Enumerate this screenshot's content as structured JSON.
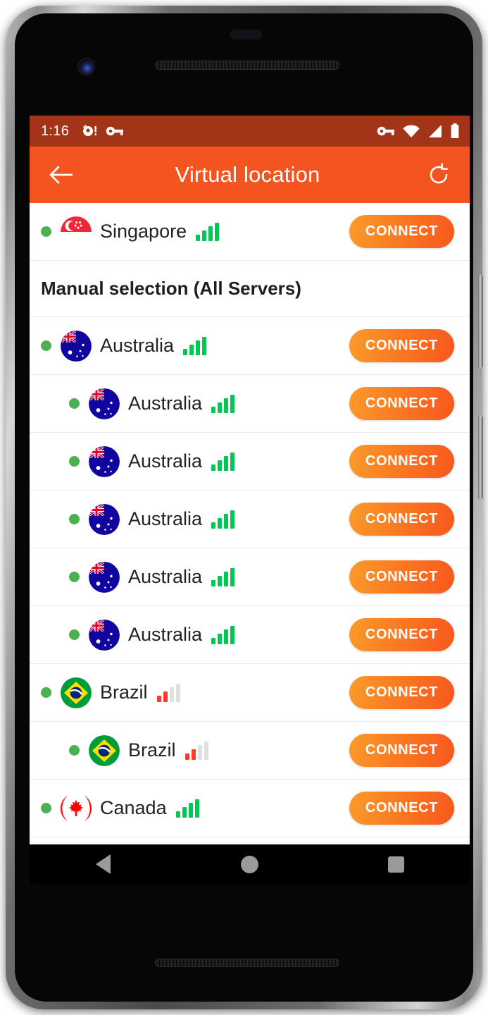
{
  "status_bar": {
    "clock": "1:16",
    "left_icons": [
      "alarm-notification-icon",
      "vpn-key-icon"
    ],
    "right_icons": [
      "vpn-key-icon",
      "wifi-icon",
      "cellular-signal-icon",
      "battery-icon"
    ],
    "background_color": "#A33418",
    "foreground_color": "#FFFFFF"
  },
  "app_bar": {
    "title": "Virtual location",
    "back_icon": "arrow-left-icon",
    "refresh_icon": "refresh-icon",
    "background_color": "#F4541F",
    "text_color": "#FFFFFF"
  },
  "list": {
    "section_header": "Manual selection (All Servers)",
    "connect_label": "CONNECT",
    "status_dot_color": "#4CAF50",
    "signal_good_color": "#00C853",
    "signal_weak_color": "#FF3B30",
    "signal_empty_color": "#E0E0E0",
    "connect_gradient_from": "#FB9B2B",
    "connect_gradient_to": "#F8571E",
    "rows": [
      {
        "name": "Singapore",
        "flag": "singapore-flag-icon",
        "level": "country",
        "status": "online",
        "signal_bars": 4,
        "signal_quality": "good",
        "connect_label": "CONNECT"
      },
      {
        "name": "Australia",
        "flag": "australia-flag-icon",
        "level": "country",
        "status": "online",
        "signal_bars": 4,
        "signal_quality": "good",
        "connect_label": "CONNECT"
      },
      {
        "name": "Australia",
        "flag": "australia-flag-icon",
        "level": "server",
        "status": "online",
        "signal_bars": 4,
        "signal_quality": "good",
        "connect_label": "CONNECT"
      },
      {
        "name": "Australia",
        "flag": "australia-flag-icon",
        "level": "server",
        "status": "online",
        "signal_bars": 4,
        "signal_quality": "good",
        "connect_label": "CONNECT"
      },
      {
        "name": "Australia",
        "flag": "australia-flag-icon",
        "level": "server",
        "status": "online",
        "signal_bars": 4,
        "signal_quality": "good",
        "connect_label": "CONNECT"
      },
      {
        "name": "Australia",
        "flag": "australia-flag-icon",
        "level": "server",
        "status": "online",
        "signal_bars": 4,
        "signal_quality": "good",
        "connect_label": "CONNECT"
      },
      {
        "name": "Australia",
        "flag": "australia-flag-icon",
        "level": "server",
        "status": "online",
        "signal_bars": 4,
        "signal_quality": "good",
        "connect_label": "CONNECT"
      },
      {
        "name": "Brazil",
        "flag": "brazil-flag-icon",
        "level": "country",
        "status": "online",
        "signal_bars": 2,
        "signal_quality": "weak",
        "connect_label": "CONNECT"
      },
      {
        "name": "Brazil",
        "flag": "brazil-flag-icon",
        "level": "server",
        "status": "online",
        "signal_bars": 2,
        "signal_quality": "weak",
        "connect_label": "CONNECT"
      },
      {
        "name": "Canada",
        "flag": "canada-flag-icon",
        "level": "country",
        "status": "online",
        "signal_bars": 4,
        "signal_quality": "good",
        "connect_label": "CONNECT"
      }
    ]
  },
  "nav_bar": {
    "back_icon": "nav-back-icon",
    "home_icon": "nav-home-icon",
    "recents_icon": "nav-recents-icon",
    "icon_color": "#9A9A9A"
  }
}
